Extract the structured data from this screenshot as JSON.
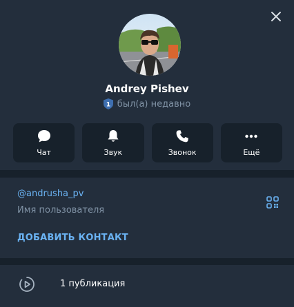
{
  "profile": {
    "name": "Andrey Pishev",
    "status": "был(а) недавно",
    "close_icon": "close-icon",
    "badge_icon": "shield-1-icon"
  },
  "actions": [
    {
      "label": "Чат",
      "icon": "chat-bubble-icon"
    },
    {
      "label": "Звук",
      "icon": "bell-icon"
    },
    {
      "label": "Звонок",
      "icon": "phone-icon"
    },
    {
      "label": "Ещё",
      "icon": "more-dots-icon"
    }
  ],
  "info": {
    "username": "@andrusha_pv",
    "username_caption": "Имя пользователя",
    "qr_icon": "qr-code-icon",
    "add_contact": "ДОБАВИТЬ КОНТАКТ"
  },
  "posts": {
    "label": "1 публикация",
    "icon": "stories-play-icon"
  },
  "colors": {
    "background": "#17212b",
    "panel": "#232e3c",
    "accent": "#6ab2f2",
    "secondary_text": "#7f91a4",
    "badge": "#3e6fb0"
  }
}
